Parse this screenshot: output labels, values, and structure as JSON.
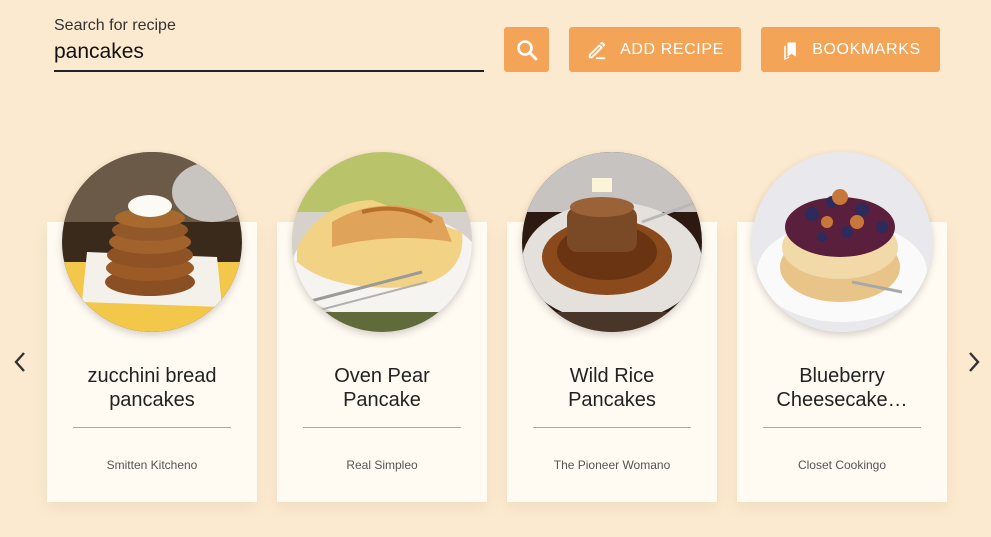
{
  "search": {
    "label": "Search for recipe",
    "value": "pancakes"
  },
  "toolbar": {
    "search_icon": "search-icon",
    "add_label": "ADD RECIPE",
    "add_icon": "pencil-icon",
    "bookmarks_label": "BOOKMARKS",
    "bookmarks_icon": "bookmarks-icon"
  },
  "colors": {
    "background": "#fcead0",
    "accent": "#f4a457",
    "card": "#fffaf2"
  },
  "recipes": [
    {
      "title_line1": "zucchini bread",
      "title_line2": "pancakes",
      "source": "Smitten Kitcheno"
    },
    {
      "title_line1": "Oven Pear",
      "title_line2": "Pancake",
      "source": "Real Simpleo"
    },
    {
      "title_line1": "Wild Rice",
      "title_line2": "Pancakes",
      "source": "The Pioneer Womano"
    },
    {
      "title_line1": "Blueberry",
      "title_line2": "Cheesecake…",
      "source": "Closet Cookingo"
    }
  ],
  "navigation": {
    "prev_icon": "chevron-left-icon",
    "next_icon": "chevron-right-icon"
  }
}
